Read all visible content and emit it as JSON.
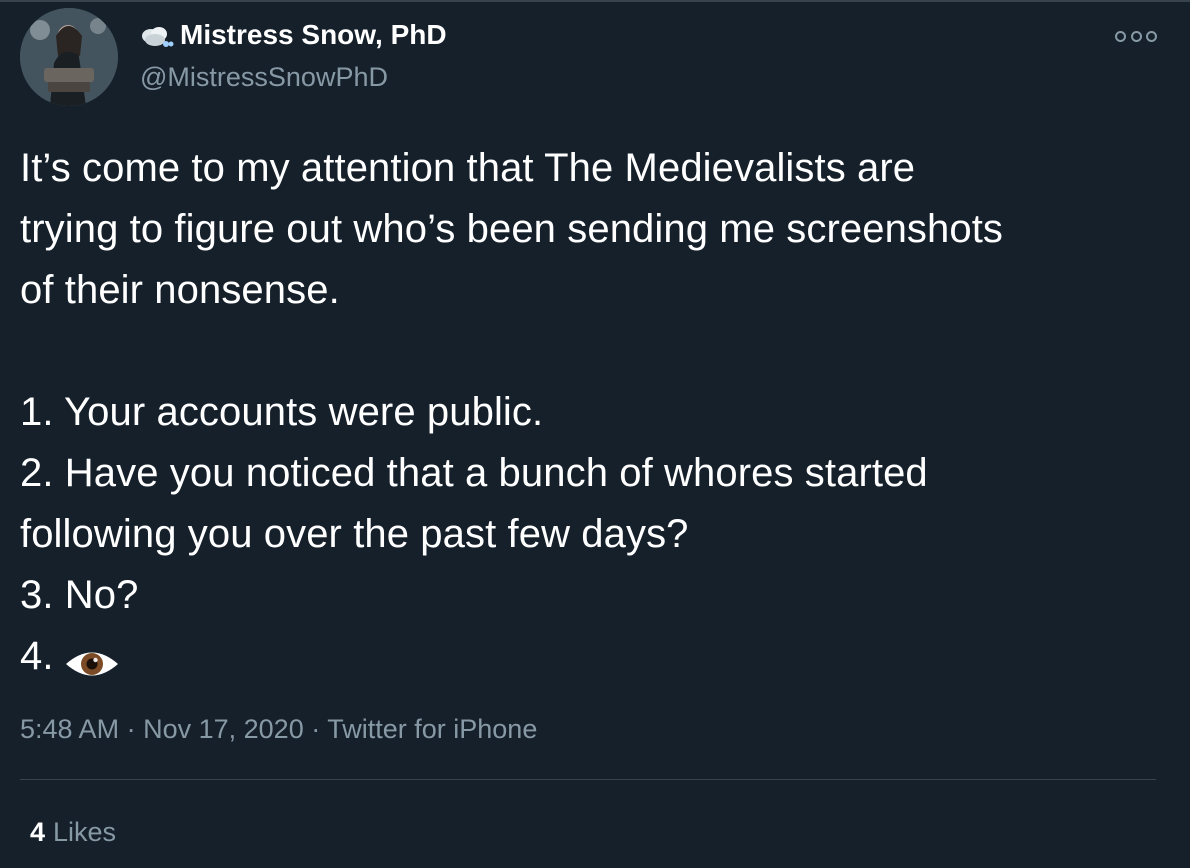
{
  "tweet": {
    "author": {
      "display_name": "Mistress Snow, PhD",
      "handle": "@MistressSnowPhD",
      "name_emoji": "snow-cloud-icon",
      "avatar": "avatar"
    },
    "more_icon": "more-options-icon",
    "lines": [
      "It’s come to my attention that The Medievalists are",
      "trying to figure out who’s been sending me screenshots",
      "of their nonsense.",
      "",
      "1. Your accounts were public.",
      "2. Have you noticed that a bunch of whores started",
      "following you over the past few days?",
      "3. No?",
      "4."
    ],
    "emoji": "eye-icon",
    "time": "5:48 AM",
    "separator": "·",
    "date": "Nov 17, 2020",
    "source": "Twitter for iPhone",
    "likes_count": "4",
    "likes_label": "Likes"
  },
  "colors": {
    "background": "#15202b",
    "text": "#ffffff",
    "secondary_text": "#8899a6",
    "divider": "#38444d"
  }
}
